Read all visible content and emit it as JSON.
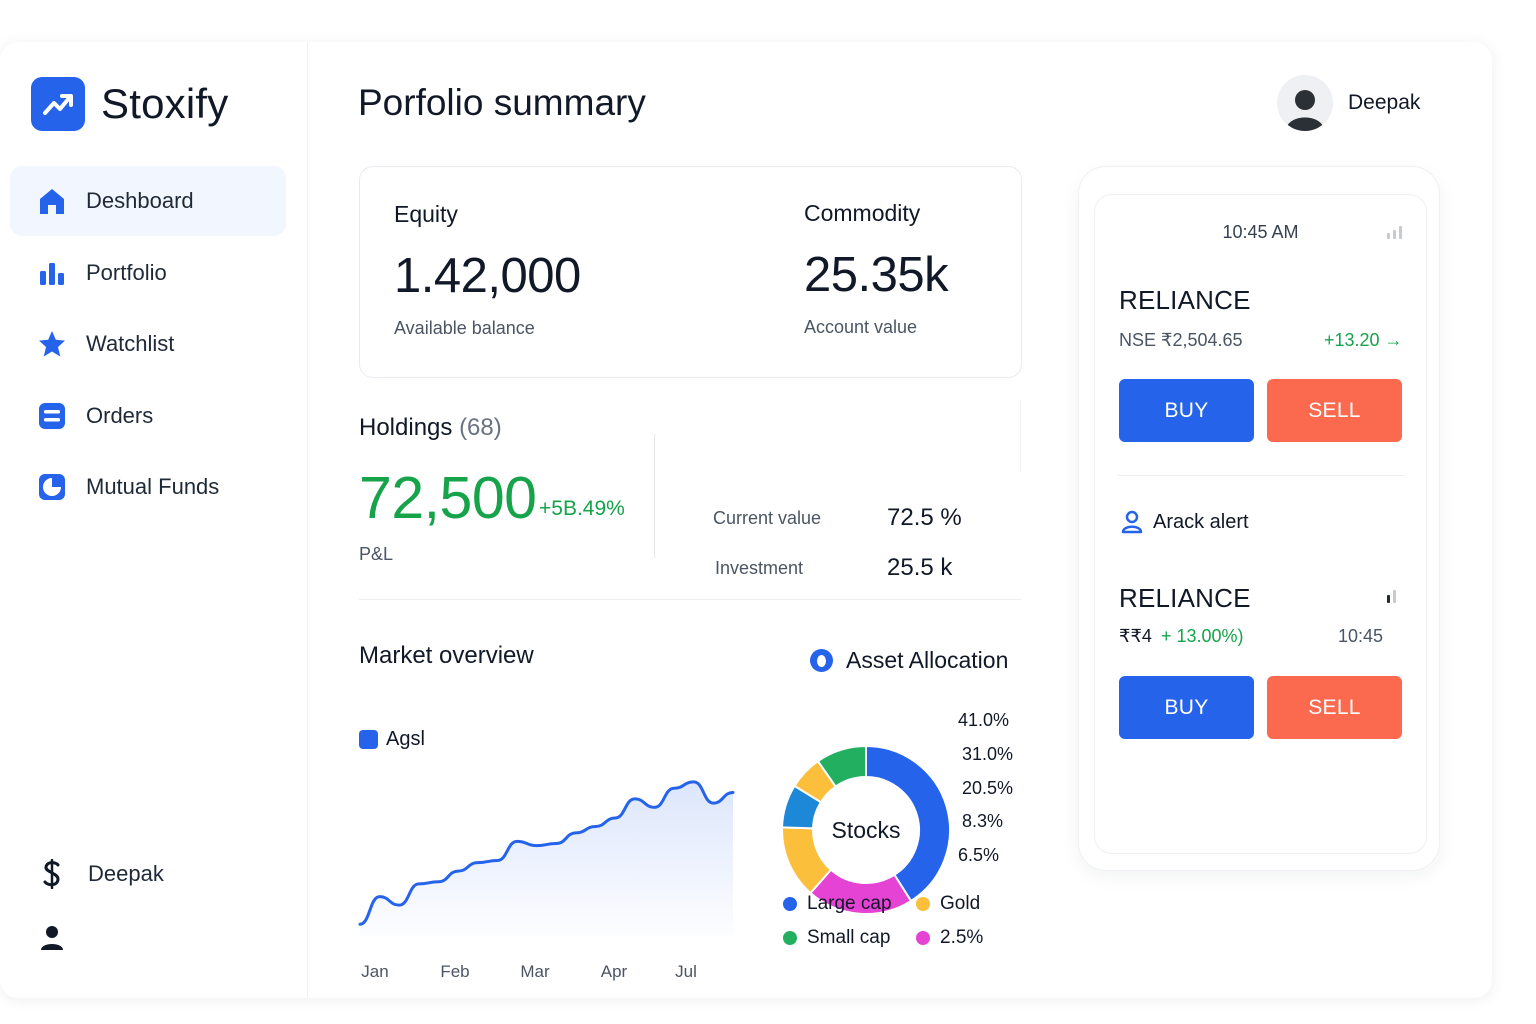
{
  "app": {
    "name": "Stoxify"
  },
  "sidebar": {
    "items": [
      {
        "label": "Deshboard",
        "icon": "home-icon",
        "active": true
      },
      {
        "label": "Portfolio",
        "icon": "bar-chart-icon"
      },
      {
        "label": "Watchlist",
        "icon": "star-icon"
      },
      {
        "label": "Orders",
        "icon": "orders-icon"
      },
      {
        "label": "Mutual Funds",
        "icon": "pie-chart-icon"
      }
    ],
    "user": {
      "name": "Deepak",
      "icon": "dollar-sign-icon"
    },
    "profile_icon": "user-icon"
  },
  "header": {
    "title": "Porfolio summary",
    "user_name": "Deepak"
  },
  "balances": {
    "equity": {
      "title": "Equity",
      "value": "1.42,000",
      "sub": "Available balance"
    },
    "commodity": {
      "title": "Commodity",
      "value": "25.35k",
      "sub": "Account value"
    }
  },
  "holdings": {
    "title": "Holdings",
    "count": "(68)",
    "value": "72,500",
    "change": "+5B.49%",
    "pl_label": "P&L",
    "metrics": [
      {
        "label": "Current value",
        "value": "72.5 %"
      },
      {
        "label": "Investment",
        "value": "25.5 k"
      }
    ]
  },
  "market": {
    "title": "Market overview",
    "legend": "Agsl",
    "months": [
      "Jan",
      "Feb",
      "Mar",
      "Apr",
      "Jul"
    ]
  },
  "allocation": {
    "title": "Asset Allocation",
    "center_label": "Stocks",
    "percentages": [
      "41.0%",
      "31.0%",
      "20.5%",
      "8.3%",
      "6.5%"
    ],
    "legend": [
      {
        "label": "Large cap",
        "color": "#2563eb"
      },
      {
        "label": "Gold",
        "color": "#fbbf3b"
      },
      {
        "label": "Small cap",
        "color": "#22b060"
      },
      {
        "label": "2.5%",
        "color": "#e443d3"
      }
    ]
  },
  "chart_data": [
    {
      "type": "area",
      "title": "Market overview",
      "series": [
        {
          "name": "Agsl",
          "color": "#2563eb",
          "values": [
            12,
            38,
            30,
            50,
            52,
            62,
            70,
            72,
            90,
            86,
            88,
            98,
            104,
            112,
            130,
            122,
            140,
            146,
            126,
            136
          ]
        }
      ],
      "x_ticks": [
        "Jan",
        "Feb",
        "Mar",
        "Apr",
        "Jul"
      ],
      "ylim": [
        0,
        160
      ],
      "grid": false
    },
    {
      "type": "pie",
      "title": "Asset Allocation",
      "center_label": "Stocks",
      "slices": [
        {
          "value": 41.0,
          "color": "#2563eb"
        },
        {
          "value": 20.5,
          "color": "#e443d3"
        },
        {
          "value": 14.0,
          "color": "#fbbf3b"
        },
        {
          "value": 8.3,
          "color": "#1e88d8"
        },
        {
          "value": 6.5,
          "color": "#fbbf3b"
        },
        {
          "value": 9.7,
          "color": "#22b060"
        }
      ],
      "labels": [
        "41.0%",
        "31.0%",
        "20.5%",
        "8.3%",
        "6.5%"
      ]
    }
  ],
  "trade_panel": {
    "time": "10:45 AM",
    "card1": {
      "symbol": "RELIANCE",
      "meta": "NSE  ₹2,504.65",
      "change": "+13.20 →",
      "buy": "BUY",
      "sell": "SELL"
    },
    "alert_label": "Arack alert",
    "card2": {
      "symbol": "RELIANCE",
      "price": "₹₹4",
      "change": "+ 13.00%)",
      "time": "10:45",
      "buy": "BUY",
      "sell": "SELL"
    }
  },
  "colors": {
    "accent": "#2563eb",
    "positive": "#16a34a",
    "sell": "#fb6a4f"
  }
}
